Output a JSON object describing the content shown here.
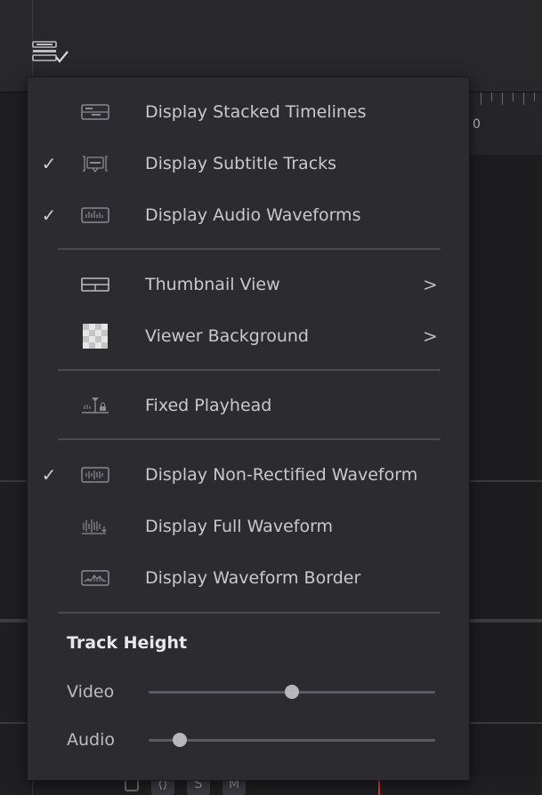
{
  "toolbar": {
    "timeline_view_options_icon": "timeline-view-options-icon"
  },
  "ruler": {
    "label": "0"
  },
  "bottom_controls": {
    "lock_icon": "lock-icon",
    "clip_icon": "clip-boundary-icon",
    "solo_label": "S",
    "mute_label": "M"
  },
  "menu": {
    "items": [
      {
        "label": "Display Stacked Timelines",
        "checked": false,
        "icon": "stacked-timelines-icon"
      },
      {
        "label": "Display Subtitle Tracks",
        "checked": true,
        "icon": "subtitle-tracks-icon"
      },
      {
        "label": "Display Audio Waveforms",
        "checked": true,
        "icon": "audio-waveforms-icon"
      },
      {
        "label": "Thumbnail View",
        "checked": false,
        "icon": "thumbnail-view-icon",
        "submenu": true
      },
      {
        "label": "Viewer Background",
        "checked": false,
        "icon": "checkerboard-icon",
        "submenu": true
      },
      {
        "label": "Fixed Playhead",
        "checked": false,
        "icon": "fixed-playhead-icon"
      },
      {
        "label": "Display Non-Rectified Waveform",
        "checked": true,
        "icon": "non-rectified-waveform-icon"
      },
      {
        "label": "Display Full Waveform",
        "checked": false,
        "icon": "full-waveform-icon"
      },
      {
        "label": "Display Waveform Border",
        "checked": false,
        "icon": "waveform-border-icon"
      }
    ],
    "check_glyph": "✓",
    "arrow_glyph": ">",
    "track_height": {
      "title": "Track Height",
      "video": {
        "label": "Video",
        "value": 0.5
      },
      "audio": {
        "label": "Audio",
        "value": 0.11
      }
    }
  },
  "colors": {
    "menu_bg": "#2c2c30",
    "text": "#c9c9cc",
    "playhead": "#e0313a"
  }
}
